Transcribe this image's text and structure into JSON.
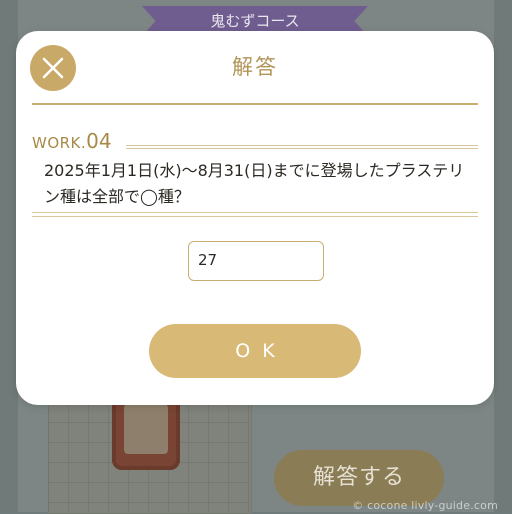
{
  "background": {
    "course_banner": "鬼むずコース",
    "answer_button_label": "解答する",
    "watermark": "© cocone livly-guide.com"
  },
  "modal": {
    "title": "解答",
    "work_prefix": "WORK.",
    "work_number": "04",
    "question": "2025年1月1日(水)〜8月31(日)までに登場したプラステリン種は全部で◯種？",
    "answer_value": "27",
    "ok_label": "OK",
    "close_icon": "close-icon"
  },
  "colors": {
    "accent_gold": "#c9a968",
    "title_gold": "#b19457",
    "ok_button": "#d8b976",
    "text": "#2d2a24"
  }
}
